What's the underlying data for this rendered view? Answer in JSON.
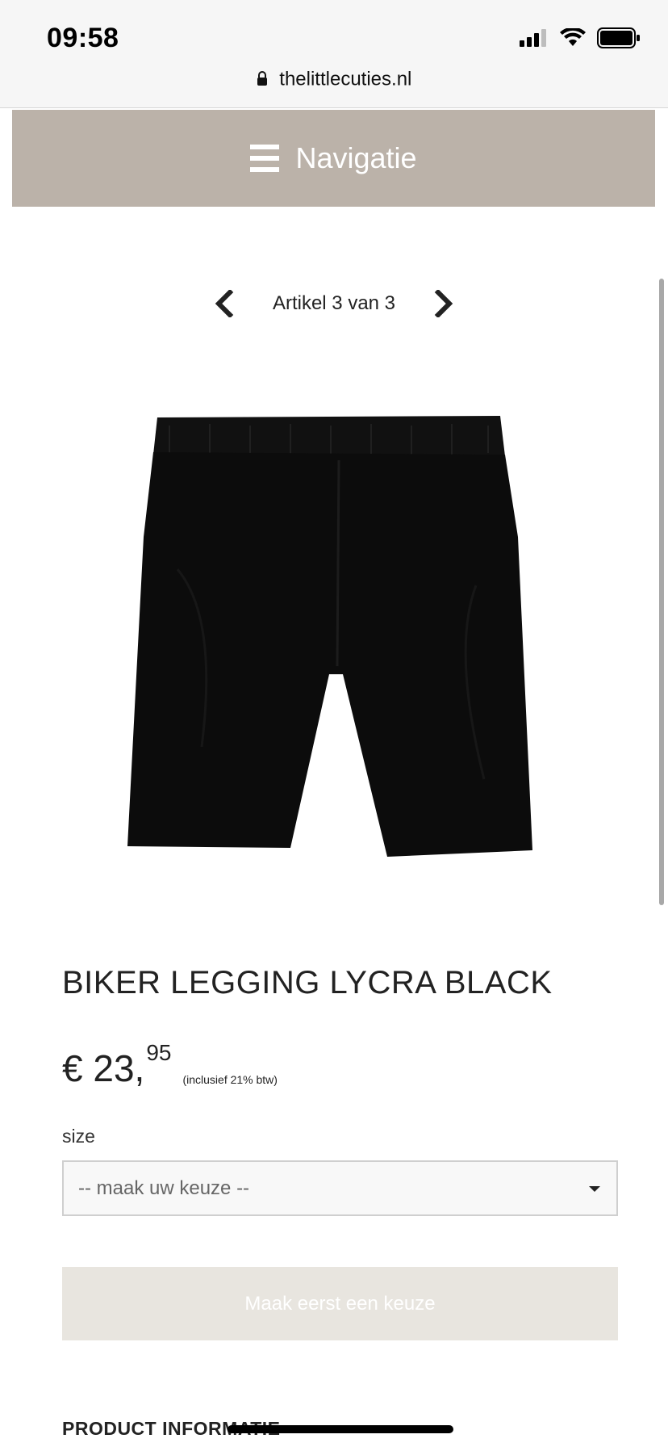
{
  "status_bar": {
    "time": "09:58",
    "url": "thelittlecuties.nl",
    "icons": [
      "signal-icon",
      "wifi-icon",
      "battery-icon",
      "lock-icon"
    ]
  },
  "navigation": {
    "label": "Navigatie",
    "icon": "hamburger-icon",
    "background": "#bbb2a9"
  },
  "pager": {
    "text": "Artikel 3 van 3",
    "prev_icon": "chevron-left-icon",
    "next_icon": "chevron-right-icon"
  },
  "product": {
    "title": "BIKER LEGGING LYCRA BLACK",
    "price_main": "€ 23,",
    "price_cents": "95",
    "vat_note": "(inclusief 21% btw)",
    "image": "black-biker-shorts"
  },
  "size": {
    "label": "size",
    "selected": "-- maak uw keuze --"
  },
  "add_button": {
    "label": "Maak eerst een keuze"
  },
  "sections": {
    "product_info_title": "PRODUCT INFORMATIE"
  }
}
